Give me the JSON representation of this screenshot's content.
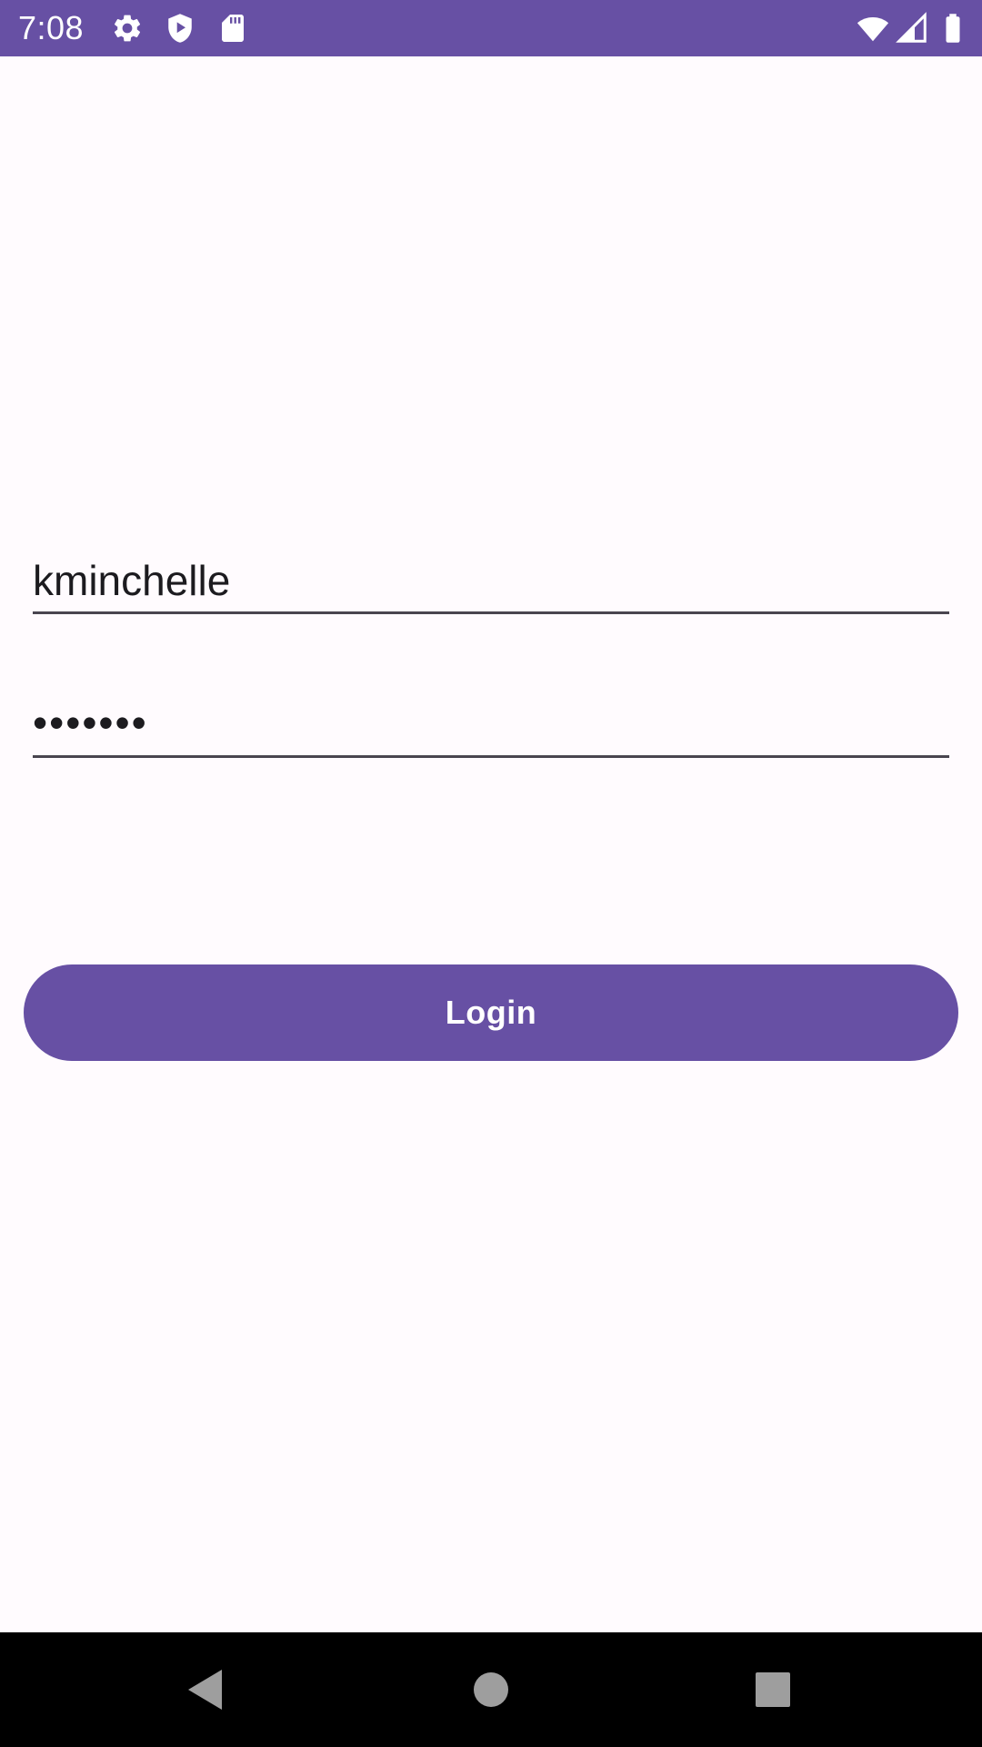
{
  "status_bar": {
    "time": "7:08",
    "background_color": "#6750A4",
    "left_icons": [
      "gear-icon",
      "shield-play-icon",
      "sd-card-icon"
    ],
    "right_icons": [
      "wifi-icon",
      "cell-signal-icon",
      "battery-icon"
    ]
  },
  "login_form": {
    "username_value": "kminchelle",
    "password_masked": "•••••••",
    "login_button_label": "Login",
    "accent_color": "#6750A4"
  },
  "nav_bar": {
    "buttons": [
      "back-icon",
      "home-icon",
      "recents-icon"
    ]
  }
}
